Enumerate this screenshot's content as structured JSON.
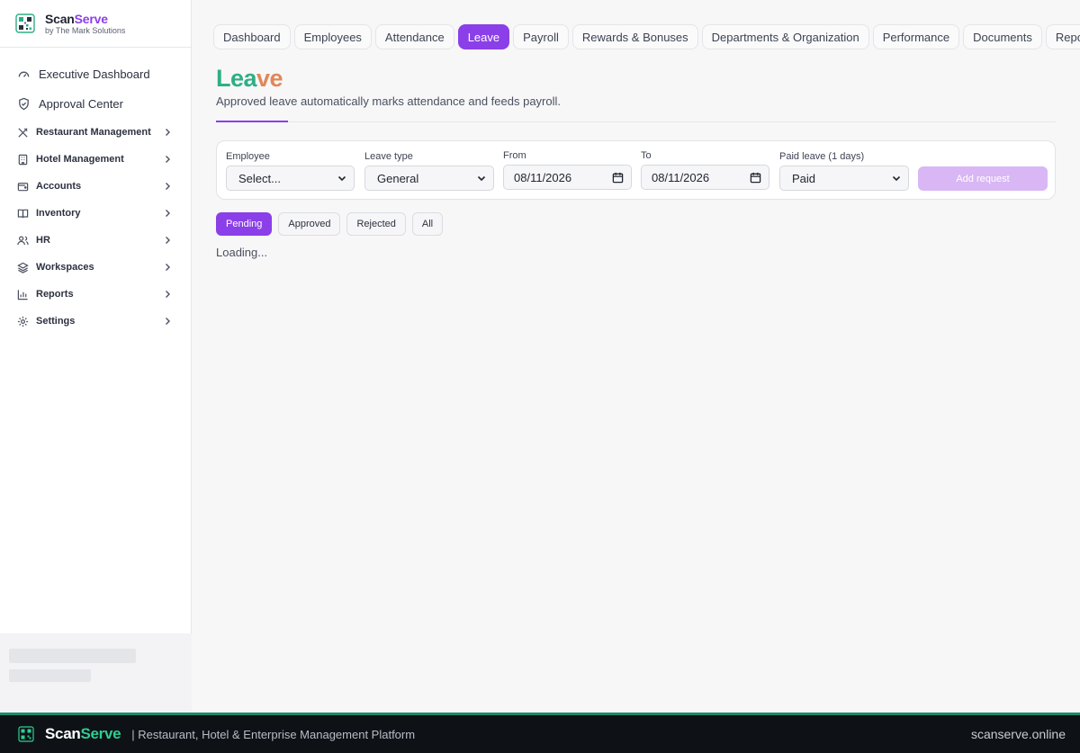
{
  "brand": {
    "name_part1": "Scan",
    "name_part2": "Serve",
    "subtitle": "by The Mark Solutions",
    "logo_icon": "qr-logo-icon",
    "accent_color": "#8b3fe8"
  },
  "sidebar": {
    "top_items": [
      {
        "label": "Executive Dashboard",
        "icon": "dashboard-gauge-icon"
      },
      {
        "label": "Approval Center",
        "icon": "shield-check-icon"
      }
    ],
    "sections": [
      {
        "label": "Restaurant Management",
        "icon": "utensils-icon"
      },
      {
        "label": "Hotel Management",
        "icon": "building-icon"
      },
      {
        "label": "Accounts",
        "icon": "wallet-icon"
      },
      {
        "label": "Inventory",
        "icon": "book-icon"
      },
      {
        "label": "HR",
        "icon": "users-icon"
      },
      {
        "label": "Workspaces",
        "icon": "layers-icon"
      },
      {
        "label": "Reports",
        "icon": "bar-chart-icon"
      },
      {
        "label": "Settings",
        "icon": "gear-icon"
      }
    ]
  },
  "tabs": [
    {
      "label": "Dashboard",
      "active": false
    },
    {
      "label": "Employees",
      "active": false
    },
    {
      "label": "Attendance",
      "active": false
    },
    {
      "label": "Leave",
      "active": true
    },
    {
      "label": "Payroll",
      "active": false
    },
    {
      "label": "Rewards & Bonuses",
      "active": false
    },
    {
      "label": "Departments & Organization",
      "active": false
    },
    {
      "label": "Performance",
      "active": false
    },
    {
      "label": "Documents",
      "active": false
    },
    {
      "label": "Reports",
      "active": false
    }
  ],
  "page": {
    "title_part1": "Lea",
    "title_part2": "ve",
    "subtitle": "Approved leave automatically marks attendance and feeds payroll."
  },
  "form": {
    "employee_label": "Employee",
    "employee_value": "Select...",
    "leave_type_label": "Leave type",
    "leave_type_value": "General",
    "from_label": "From",
    "from_value": "08/11/2026",
    "to_label": "To",
    "to_value": "08/11/2026",
    "paid_label": "Paid leave (1 days)",
    "paid_value": "Paid",
    "add_button": "Add request"
  },
  "filters": [
    {
      "label": "Pending",
      "active": true
    },
    {
      "label": "Approved",
      "active": false
    },
    {
      "label": "Rejected",
      "active": false
    },
    {
      "label": "All",
      "active": false
    }
  ],
  "loading_text": "Loading...",
  "footer": {
    "brand_part1": "Scan",
    "brand_part2": "Serve",
    "tagline": "| Restaurant, Hotel & Enterprise Management Platform",
    "domain": "scanserve.online"
  }
}
